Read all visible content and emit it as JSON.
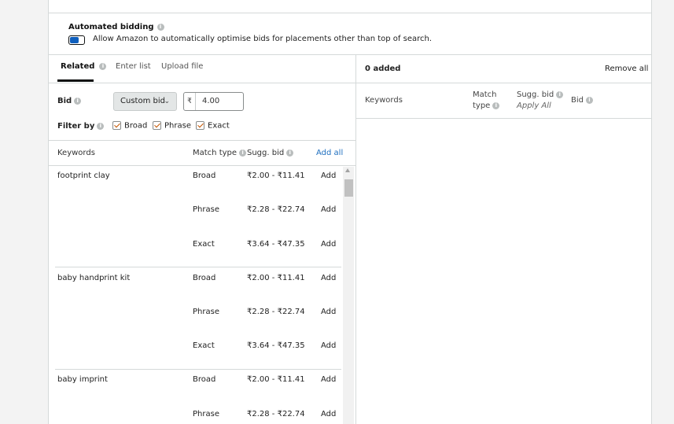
{
  "automated_bidding": {
    "title": "Automated bidding",
    "description": "Allow Amazon to automatically optimise bids for placements other than top of search."
  },
  "tabs": [
    {
      "label": "Related"
    },
    {
      "label": "Enter list"
    },
    {
      "label": "Upload file"
    }
  ],
  "bid": {
    "label": "Bid",
    "dropdown_value": "Custom bid",
    "currency": "₹",
    "value": "4.00"
  },
  "filter": {
    "label": "Filter by",
    "options": [
      {
        "label": "Broad",
        "checked": true
      },
      {
        "label": "Phrase",
        "checked": true
      },
      {
        "label": "Exact",
        "checked": true
      }
    ]
  },
  "table": {
    "headers": {
      "keywords": "Keywords",
      "match_type": "Match type",
      "sugg_bid": "Sugg. bid",
      "add_all": "Add all"
    },
    "groups": [
      {
        "keyword": "footprint clay",
        "rows": [
          {
            "match": "Broad",
            "range": "₹2.00 - ₹11.41",
            "action": "Add"
          },
          {
            "match": "Phrase",
            "range": "₹2.28 - ₹22.74",
            "action": "Add"
          },
          {
            "match": "Exact",
            "range": "₹3.64 - ₹47.35",
            "action": "Add"
          }
        ]
      },
      {
        "keyword": "baby handprint kit",
        "rows": [
          {
            "match": "Broad",
            "range": "₹2.00 - ₹11.41",
            "action": "Add"
          },
          {
            "match": "Phrase",
            "range": "₹2.28 - ₹22.74",
            "action": "Add"
          },
          {
            "match": "Exact",
            "range": "₹3.64 - ₹47.35",
            "action": "Add"
          }
        ]
      },
      {
        "keyword": "baby imprint",
        "rows": [
          {
            "match": "Broad",
            "range": "₹2.00 - ₹11.41",
            "action": "Add"
          },
          {
            "match": "Phrase",
            "range": "₹2.28 - ₹22.74",
            "action": "Add"
          }
        ]
      }
    ]
  },
  "added_panel": {
    "count_label": "0 added",
    "remove_all": "Remove all",
    "headers": {
      "keywords": "Keywords",
      "match_line1": "Match",
      "match_line2": "type",
      "sugg_bid": "Sugg. bid",
      "apply_all": "Apply All",
      "bid": "Bid"
    }
  },
  "colors": {
    "link": "#1f6fbf",
    "toggle_on": "#0f5fbd",
    "checkbox_mark": "#c45500"
  }
}
